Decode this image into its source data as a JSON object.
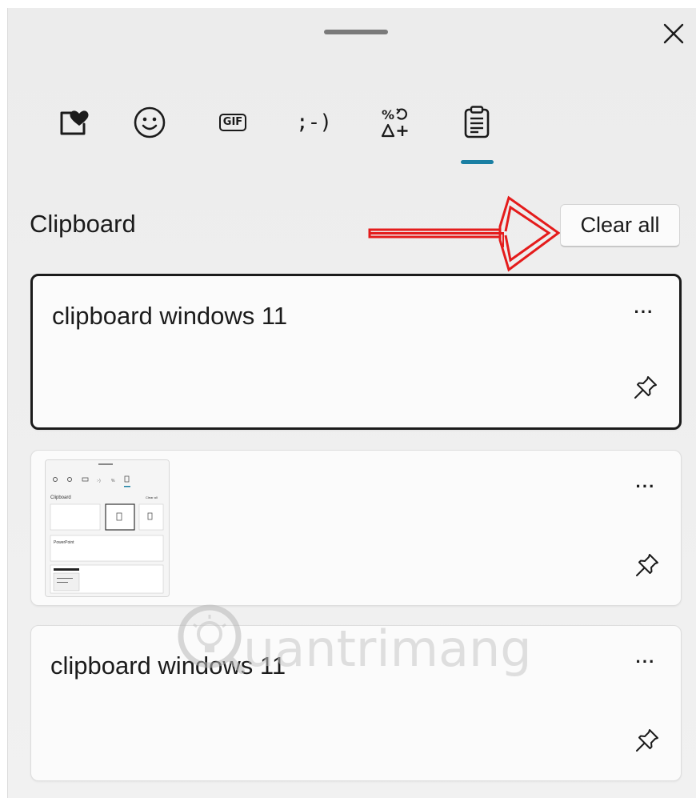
{
  "header": {
    "drag_handle": "drag-handle",
    "close_icon": "close-icon"
  },
  "tabs": [
    {
      "name": "favorites",
      "icon": "heart-note-icon"
    },
    {
      "name": "emoji",
      "icon": "smiley-icon"
    },
    {
      "name": "gif",
      "icon": "gif-icon",
      "label": "GIF"
    },
    {
      "name": "kaomoji",
      "icon": "kaomoji-icon",
      "label": ";-)"
    },
    {
      "name": "symbols",
      "icon": "symbols-icon"
    },
    {
      "name": "clipboard",
      "icon": "clipboard-icon",
      "selected": true
    }
  ],
  "section": {
    "title": "Clipboard",
    "clear_all_label": "Clear all"
  },
  "items": [
    {
      "type": "text",
      "text": "clipboard windows 11",
      "selected": true
    },
    {
      "type": "image",
      "thumbnail_texts": [
        "Clipboard",
        "Clear all",
        "PowerPoint"
      ]
    },
    {
      "type": "text",
      "text": "clipboard windows 11",
      "selected": false
    }
  ],
  "item_actions": {
    "more_label": "···"
  },
  "watermark": {
    "text": "Quantrimang"
  },
  "colors": {
    "accent": "#1a7fa3",
    "annotation_arrow": "#e41c1c",
    "panel_bg": "#eeeeee"
  }
}
